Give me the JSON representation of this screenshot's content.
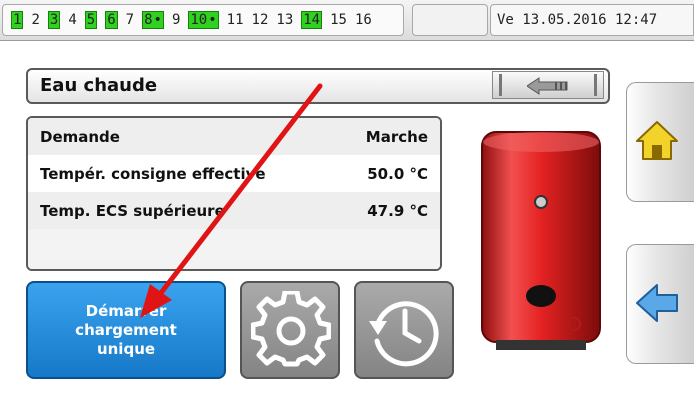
{
  "status_bar": {
    "outputs": [
      {
        "label": "1",
        "active": true
      },
      {
        "label": "2",
        "active": false
      },
      {
        "label": "3",
        "active": true
      },
      {
        "label": "4",
        "active": false
      },
      {
        "label": "5",
        "active": true
      },
      {
        "label": "6",
        "active": true
      },
      {
        "label": "7",
        "active": false
      },
      {
        "label": "8",
        "active": true,
        "dot": true
      },
      {
        "label": "9",
        "active": false
      },
      {
        "label": "10",
        "active": true,
        "dot": true
      },
      {
        "label": "11",
        "active": false
      },
      {
        "label": "12",
        "active": false
      },
      {
        "label": "13",
        "active": false
      },
      {
        "label": "14",
        "active": true
      },
      {
        "label": "15",
        "active": false
      },
      {
        "label": "16",
        "active": false
      }
    ],
    "datetime": "Ve 13.05.2016 12:47"
  },
  "header": {
    "title": "Eau chaude",
    "back_icon": "back-arrow-icon"
  },
  "values": [
    {
      "label": "Demande",
      "value": "Marche"
    },
    {
      "label": "Tempér. consigne effective",
      "value": "50.0 °C"
    },
    {
      "label": "Temp. ECS supérieure",
      "value": "47.9 °C"
    }
  ],
  "buttons": {
    "start_line1": "Démarrer",
    "start_line2": "chargement",
    "start_line3": "unique",
    "settings_icon": "gear-icon",
    "timer_icon": "clock-history-icon"
  },
  "nav": {
    "home_icon": "home-icon",
    "back_icon": "left-arrow-icon"
  },
  "colors": {
    "active_output": "#2fd21f",
    "start_button": "#1f8ad9",
    "tank": "#e52222",
    "annotation_arrow": "#e01414"
  }
}
